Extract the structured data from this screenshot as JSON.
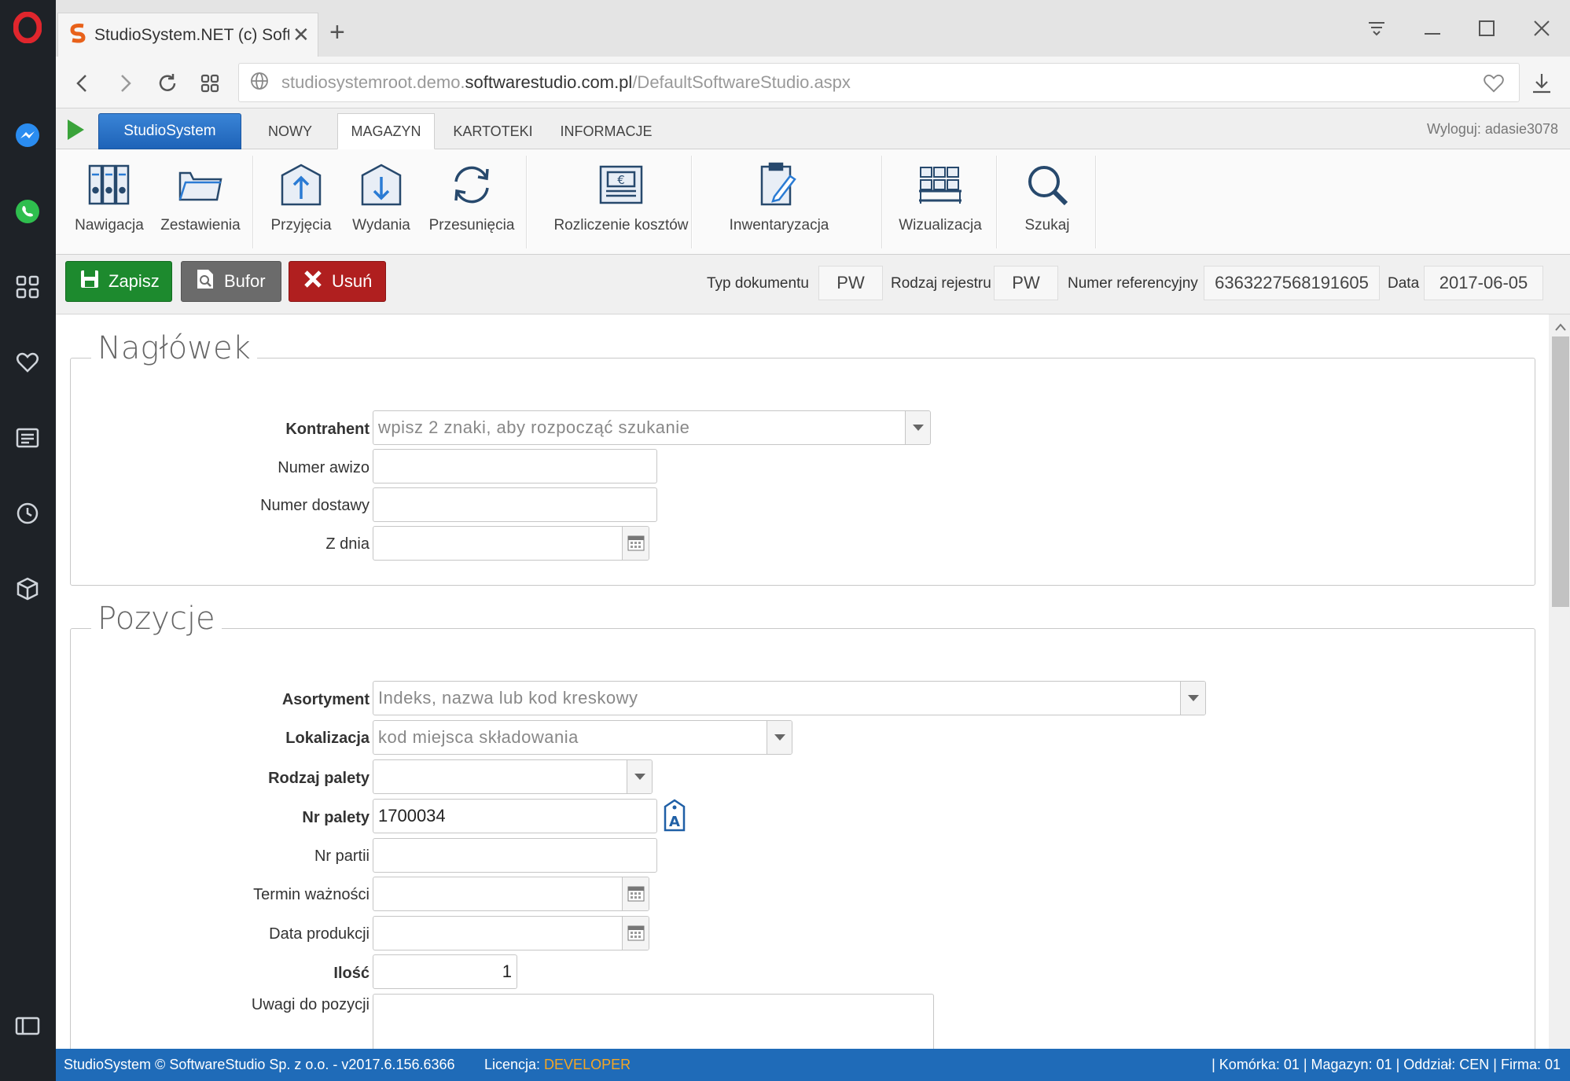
{
  "browser": {
    "tab_title": "StudioSystem.NET (c) Softw",
    "url_prefix": "studiosystemroot.demo.",
    "url_domain": "softwarestudio.com.pl",
    "url_path": "/DefaultSoftwareStudio.aspx"
  },
  "menu": {
    "brand": "StudioSystem",
    "tabs": [
      "NOWY",
      "MAGAZYN",
      "KARTOTEKI",
      "INFORMACJE"
    ],
    "active_tab": "MAGAZYN",
    "logout": "Wyloguj: adasie3078"
  },
  "ribbon": {
    "items": [
      {
        "label": "Nawigacja",
        "icon": "binders-icon"
      },
      {
        "label": "Zestawienia",
        "icon": "folder-icon"
      },
      {
        "label": "Przyjęcia",
        "icon": "receipt-upload-icon"
      },
      {
        "label": "Wydania",
        "icon": "issue-download-icon"
      },
      {
        "label": "Przesunięcia",
        "icon": "refresh-icon"
      },
      {
        "label": "Rozliczenie kosztów",
        "icon": "invoice-euro-icon"
      },
      {
        "label": "Inwentaryzacja",
        "icon": "clipboard-pen-icon"
      },
      {
        "label": "Wizualizacja",
        "icon": "warehouse-racks-icon"
      },
      {
        "label": "Szukaj",
        "icon": "search-icon"
      }
    ]
  },
  "actions": {
    "save": "Zapisz",
    "buffer": "Bufor",
    "delete": "Usuń"
  },
  "doc_meta": {
    "type_label": "Typ dokumentu",
    "type_value": "PW",
    "register_label": "Rodzaj rejestru",
    "register_value": "PW",
    "ref_label": "Numer referencyjny",
    "ref_value": "6363227568191605",
    "date_label": "Data",
    "date_value": "2017-06-05"
  },
  "header_section": {
    "legend": "Nagłówek",
    "contractor_label": "Kontrahent",
    "contractor_placeholder": "wpisz 2 znaki, aby rozpocząć szukanie",
    "advice_label": "Numer awizo",
    "delivery_label": "Numer dostawy",
    "from_date_label": "Z dnia"
  },
  "positions_section": {
    "legend": "Pozycje",
    "assortment_label": "Asortyment",
    "assortment_placeholder": "Indeks, nazwa lub kod kreskowy",
    "location_label": "Lokalizacja",
    "location_placeholder": "kod miejsca składowania",
    "pallet_type_label": "Rodzaj palety",
    "pallet_no_label": "Nr palety",
    "pallet_no_value": "1700034",
    "batch_label": "Nr partii",
    "expiry_label": "Termin ważności",
    "production_label": "Data produkcji",
    "quantity_label": "Ilość",
    "quantity_value": "1",
    "remarks_label": "Uwagi do pozycji"
  },
  "status": {
    "copyright": "StudioSystem © SoftwareStudio Sp. z o.o. - v2017.6.156.6366",
    "license_label": "Licencja: ",
    "license_value": "DEVELOPER",
    "location": "| Komórka: 01 | Magazyn: 01 | Oddział: CEN | Firma: 01"
  },
  "colors": {
    "brand_blue": "#1f6bb8",
    "save_green": "#1d8a2e",
    "buffer_gray": "#6b6b6b",
    "delete_red": "#b01f1f",
    "license_orange": "#f5a623"
  }
}
